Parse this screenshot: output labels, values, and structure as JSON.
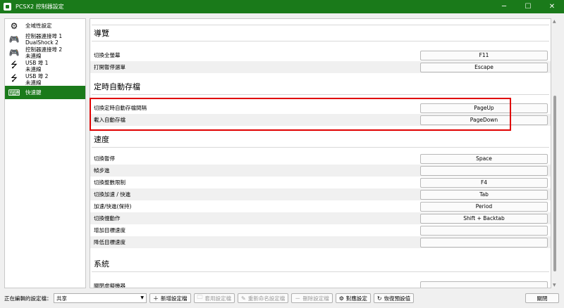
{
  "window": {
    "title": "PCSX2 控制器設定",
    "minimize": "─",
    "maximize": "☐",
    "close": "✕"
  },
  "sidebar": {
    "items": [
      {
        "line1": "全域性設定",
        "line2": "",
        "icon": "⚙"
      },
      {
        "line1": "控制器連接埠 1",
        "line2": "DualShock 2",
        "icon": "🎮"
      },
      {
        "line1": "控制器連接埠 2",
        "line2": "未連線",
        "icon": "🎮"
      },
      {
        "line1": "USB 埠 1",
        "line2": "未連線",
        "icon": "⭍"
      },
      {
        "line1": "USB 埠 2",
        "line2": "未連線",
        "icon": "⭍"
      },
      {
        "line1": "快速鍵",
        "line2": "",
        "icon": "⌨"
      }
    ]
  },
  "sections": [
    {
      "title": "導覽",
      "rows": [
        {
          "label": "切換全螢幕",
          "key": "F11"
        },
        {
          "label": "打開暫停選單",
          "key": "Escape"
        }
      ]
    },
    {
      "title": "定時自動存檔",
      "rows": [
        {
          "label": "切換定時自動存檔間隔",
          "key": "PageUp"
        },
        {
          "label": "載入自動存檔",
          "key": "PageDown"
        }
      ]
    },
    {
      "title": "速度",
      "rows": [
        {
          "label": "切換暫停",
          "key": "Space"
        },
        {
          "label": "幀步進",
          "key": ""
        },
        {
          "label": "切換整數限制",
          "key": "F4"
        },
        {
          "label": "切換加速 / 快進",
          "key": "Tab"
        },
        {
          "label": "加速/快進(保持)",
          "key": "Period"
        },
        {
          "label": "切換慢動作",
          "key": "Shift + Backtab"
        },
        {
          "label": "增加目標速度",
          "key": ""
        },
        {
          "label": "降低目標速度",
          "key": ""
        }
      ]
    },
    {
      "title": "系統",
      "rows": [
        {
          "label": "關閉虛擬機器",
          "key": ""
        }
      ]
    }
  ],
  "bottom": {
    "editing_label": "正在編輯的設定檔：",
    "profile_value": "共享",
    "new_profile": "新增設定檔",
    "apply_profile": "套用設定檔",
    "rename_profile": "重新命名設定檔",
    "delete_profile": "刪除設定檔",
    "mapping_settings": "對應設定",
    "restore_defaults": "恢復預設值",
    "close": "關閉"
  },
  "colors": {
    "accent": "#1a7a1a",
    "highlight": "#e00000"
  }
}
